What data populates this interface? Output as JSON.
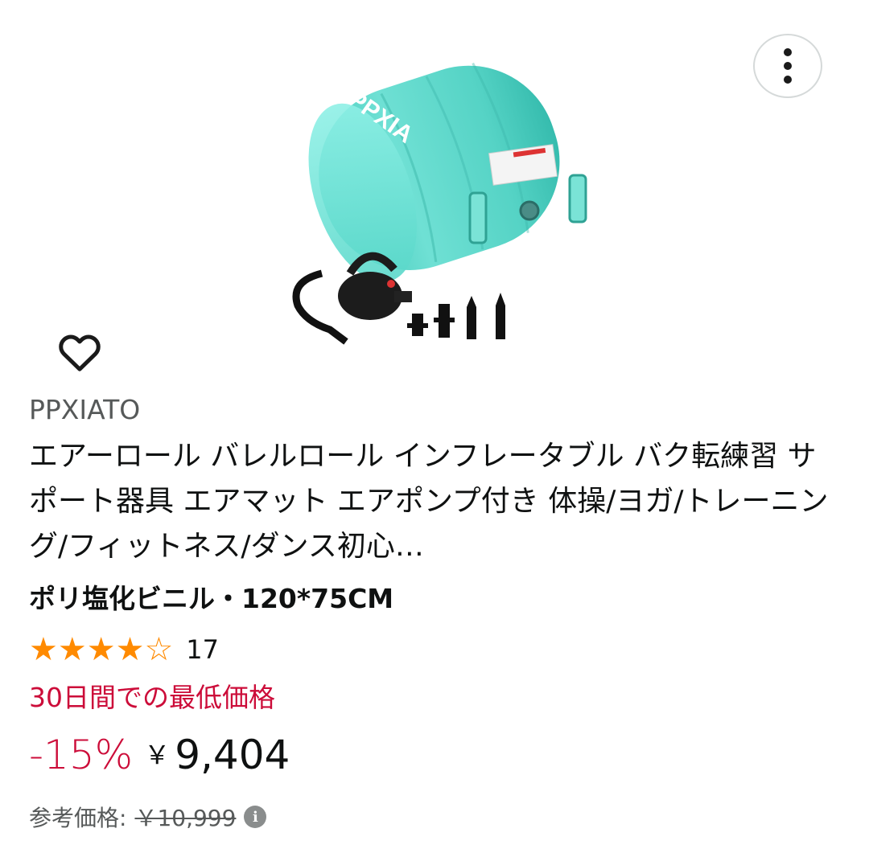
{
  "product": {
    "brand": "PPXIATO",
    "title": "エアーロール バレルロール インフレータブル バク転練習 サポート器具 エアマット エアポンプ付き 体操/ヨガ/トレーニング/フィットネス/ダンス初心…",
    "variant": "ポリ塩化ビニル・120*75CM",
    "image_logo": "PPXIA"
  },
  "rating": {
    "stars": 4,
    "max_stars": 5,
    "count": "17"
  },
  "deal": {
    "label": "30日間での最低価格",
    "discount": "-15%",
    "currency": "￥",
    "price": "9,404"
  },
  "reference": {
    "label": "参考価格:",
    "price": "￥10,999"
  },
  "icons": {
    "more": "more-vertical-icon",
    "wishlist": "heart-outline-icon",
    "info": "info-icon"
  },
  "colors": {
    "deal_red": "#cc0c39",
    "star_orange": "#ff8a00",
    "product_teal": "#5fd6c9"
  }
}
